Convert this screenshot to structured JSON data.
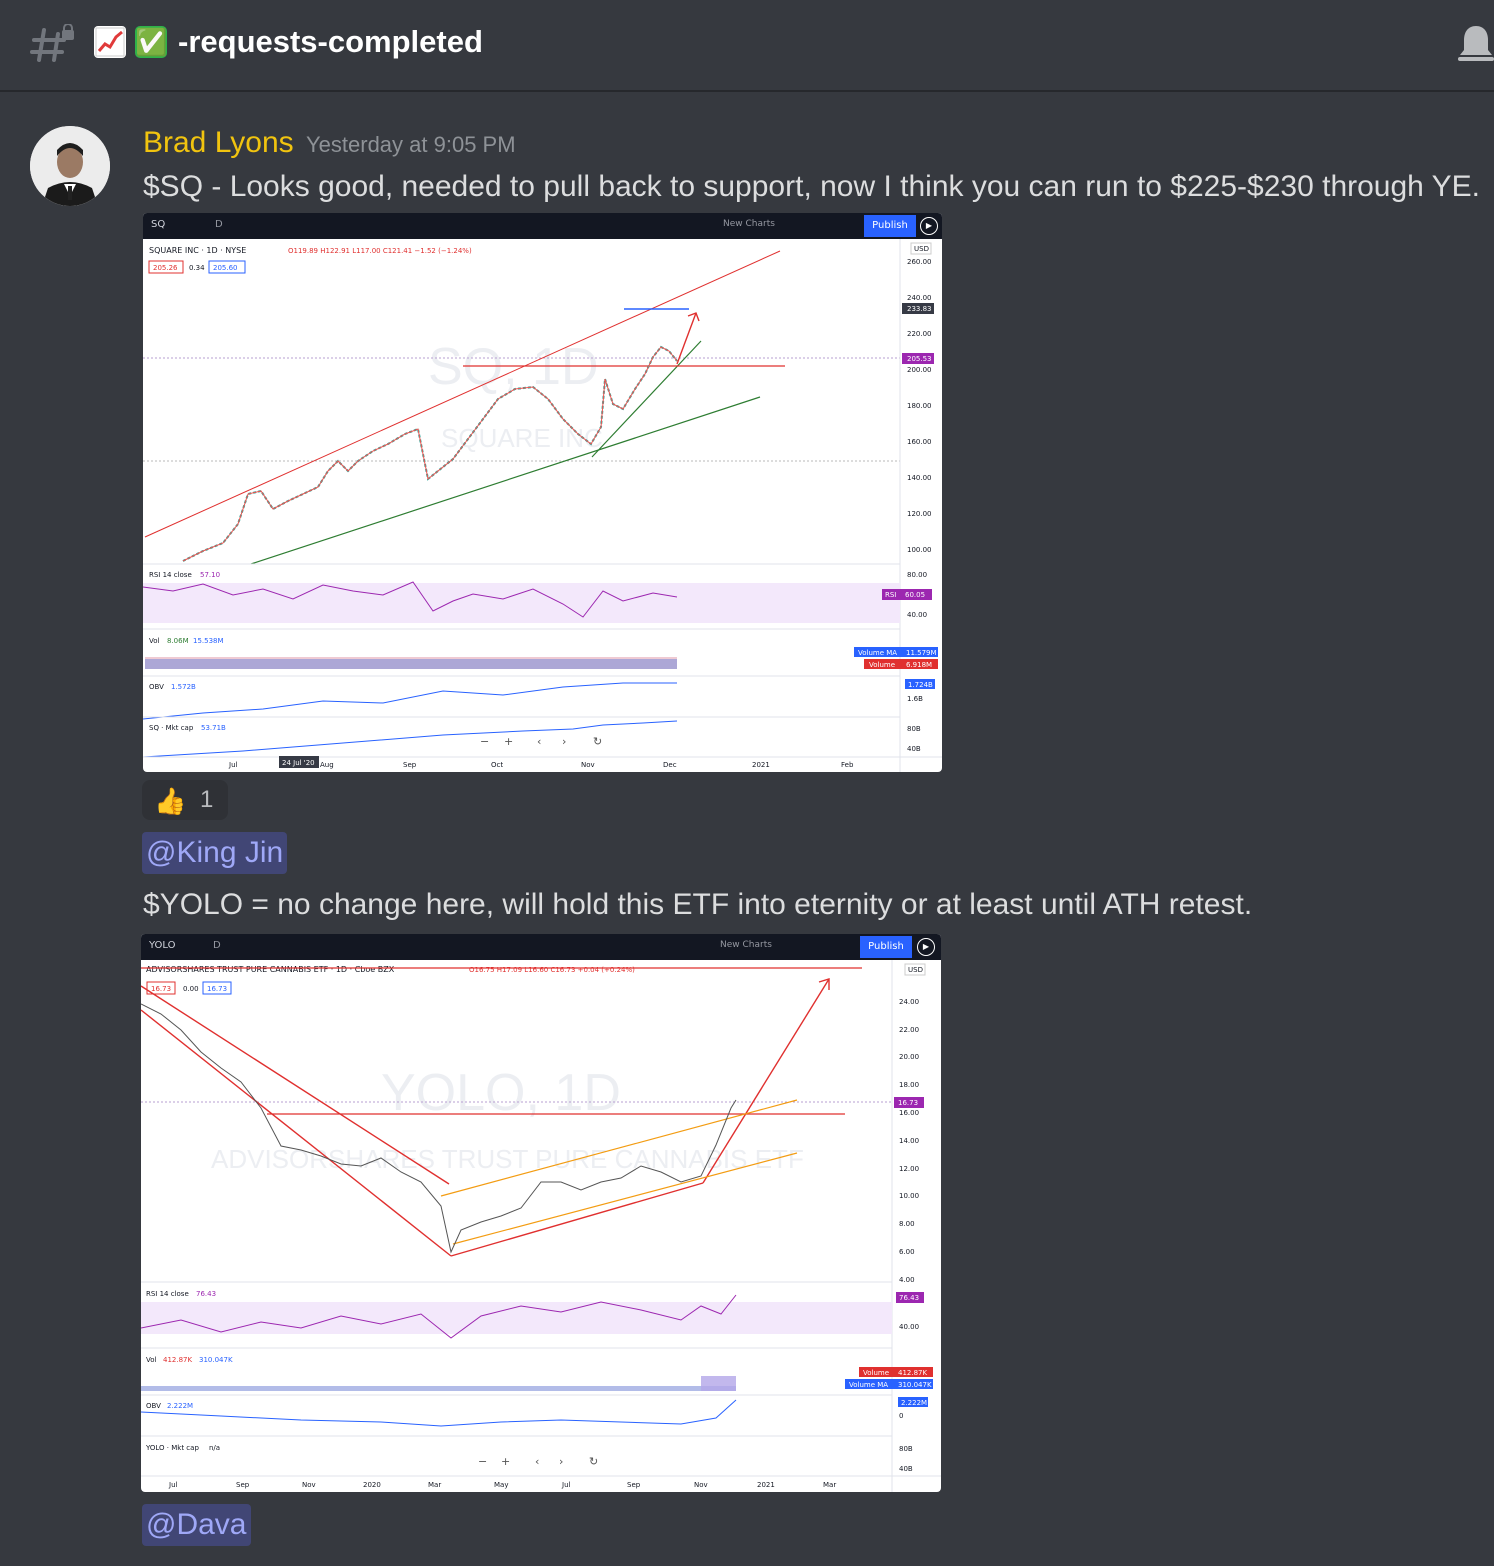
{
  "channel": {
    "emoji_check": "✅",
    "name": "-requests-completed"
  },
  "message": {
    "author": "Brad Lyons",
    "timestamp": "Yesterday at 9:05 PM",
    "text1": "$SQ - Looks good, needed to pull back to support, now I think you can run to $225-$230 through YE.",
    "reaction": {
      "emoji": "👍",
      "count": "1"
    },
    "mention1": "@King Jin",
    "text2": "$YOLO = no change here, will hold this ETF into eternity or at least until ATH retest.",
    "mention2": "@Dava"
  },
  "chart1": {
    "symbol": "SQ",
    "toolbar": {
      "interval": "D",
      "new_charts": "New Charts",
      "publish": "Publish"
    },
    "header": "SQUARE INC · 1D · NYSE",
    "ohlc": "O119.89 H122.91 L117.00 C121.41 −1.52 (−1.24%)",
    "bid": "205.26",
    "spread": "0.34",
    "ask": "205.60",
    "watermark_big": "SQ, 1D",
    "watermark_small": "SQUARE INC",
    "currency": "USD",
    "y_ticks": [
      "260.00",
      "240.00",
      "220.00",
      "200.00",
      "180.00",
      "160.00",
      "140.00",
      "120.00",
      "100.00"
    ],
    "price_tag": "205.53",
    "target_tag": "233.83",
    "rsi_label": "RSI 14 close",
    "rsi_value": "57.10",
    "rsi_tag": "RSI",
    "rsi_tag_value": "60.05",
    "rsi_ticks": [
      "80.00",
      "40.00"
    ],
    "vol_label": "Vol",
    "vol_value1": "8.06M",
    "vol_value2": "15.538M",
    "vol_ma_tag": "Volume MA",
    "vol_ma_value": "11.579M",
    "vol_tag": "Volume",
    "vol_tag_value": "6.918M",
    "obv_label": "OBV",
    "obv_value": "1.572B",
    "obv_tag_value": "1.724B",
    "obv_tick": "1.6B",
    "mcap_label": "SQ · Mkt cap",
    "mcap_value": "53.71B",
    "mcap_ticks": [
      "80B",
      "40B"
    ],
    "x_ticks": [
      "Jul",
      "Aug",
      "Sep",
      "Oct",
      "Nov",
      "Dec",
      "2021",
      "Feb"
    ],
    "crosshair_date": "24 Jul '20"
  },
  "chart2": {
    "symbol": "YOLO",
    "toolbar": {
      "interval": "D",
      "new_charts": "New Charts",
      "publish": "Publish"
    },
    "header": "ADVISORSHARES TRUST PURE CANNABIS ETF · 1D · Cboe BZX",
    "ohlc": "O16.75 H17.09 L16.60 C16.73 +0.04 (+0.24%)",
    "bid": "16.73",
    "spread": "0.00",
    "ask": "16.73",
    "watermark_big": "YOLO, 1D",
    "watermark_small": "ADVISORSHARES TRUST PURE CANNABIS ETF",
    "currency": "USD",
    "y_ticks": [
      "24.00",
      "22.00",
      "20.00",
      "18.00",
      "16.00",
      "14.00",
      "12.00",
      "10.00",
      "8.00",
      "6.00",
      "4.00"
    ],
    "price_tag": "16.73",
    "rsi_label": "RSI 14 close",
    "rsi_value": "76.43",
    "rsi_tag_value": "76.43",
    "rsi_tick": "40.00",
    "vol_label": "Vol",
    "vol_value1": "412.87K",
    "vol_value2": "310.047K",
    "vol_tag": "Volume",
    "vol_tag_value": "412.87K",
    "vol_ma_tag": "Volume MA",
    "vol_ma_value": "310.047K",
    "obv_label": "OBV",
    "obv_value": "2.222M",
    "obv_tag_value": "2.222M",
    "obv_tick": "0",
    "mcap_label": "YOLO · Mkt cap",
    "mcap_value": "n/a",
    "mcap_ticks": [
      "80B",
      "40B"
    ],
    "x_ticks": [
      "Jul",
      "Sep",
      "Nov",
      "2020",
      "Mar",
      "May",
      "Jul",
      "Sep",
      "Nov",
      "2021",
      "Mar"
    ]
  }
}
